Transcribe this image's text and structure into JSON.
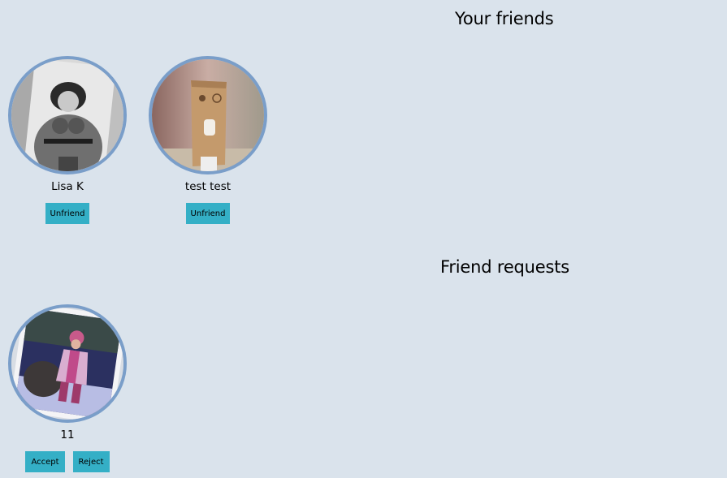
{
  "friends": {
    "title": "Your friends",
    "items": [
      {
        "name": "Lisa K",
        "unfriend_label": "Unfriend"
      },
      {
        "name": "test test",
        "unfriend_label": "Unfriend"
      }
    ]
  },
  "requests": {
    "title": "Friend requests",
    "items": [
      {
        "name": "11",
        "accept_label": "Accept",
        "reject_label": "Reject"
      }
    ]
  },
  "colors": {
    "background": "#dae3ec",
    "avatar_border": "#7a9ec9",
    "button": "#34afc6"
  }
}
